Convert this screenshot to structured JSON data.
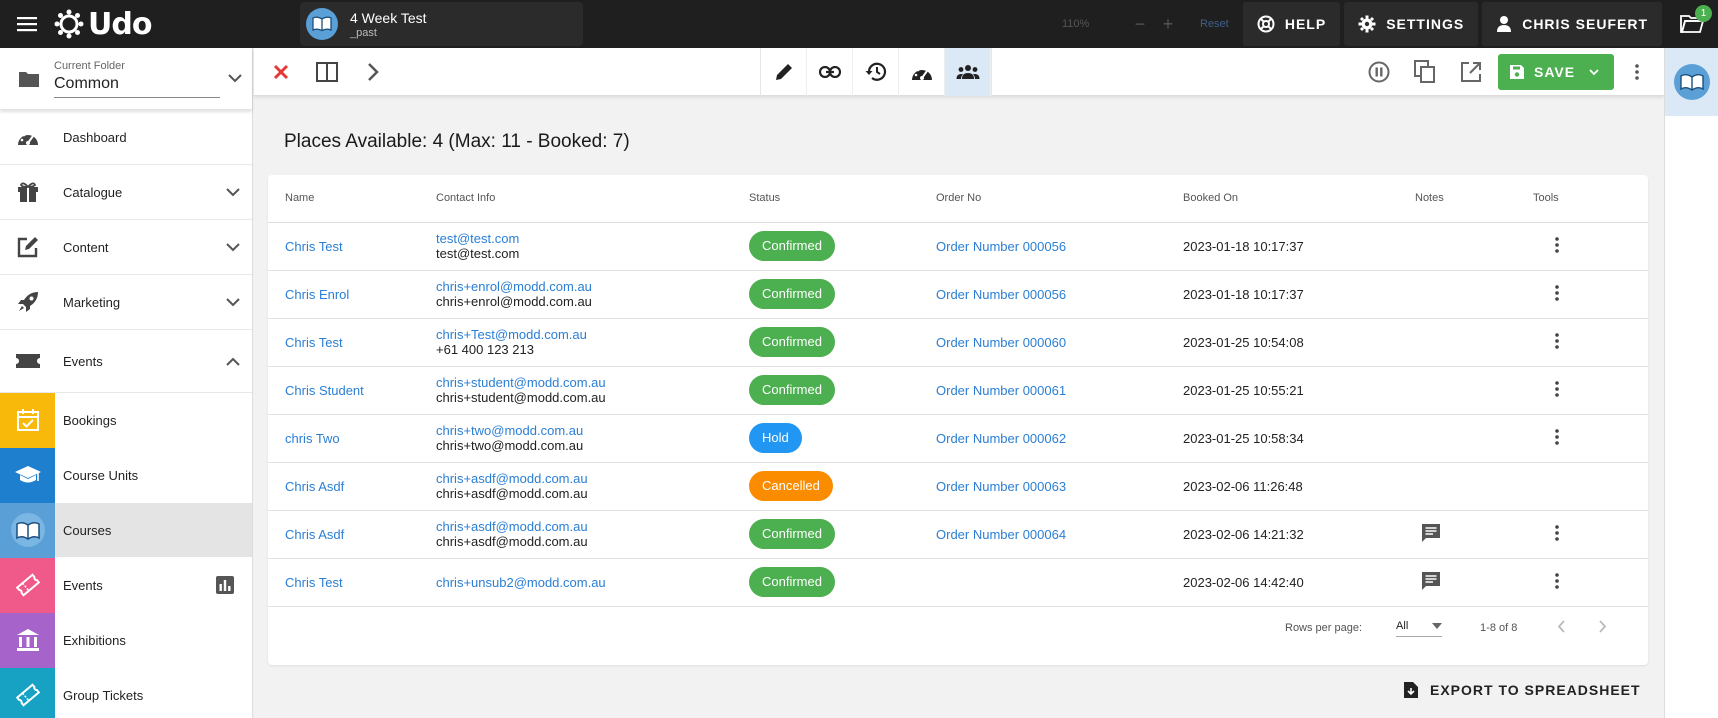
{
  "app": {
    "logo_text": "Udo",
    "document": {
      "title": "4 Week Test",
      "subtitle": "_past"
    },
    "zoom": {
      "value": "110%",
      "reset_label": "Reset"
    },
    "help_label": "HELP",
    "settings_label": "SETTINGS",
    "user_label": "CHRIS SEUFERT",
    "folder_badge": "1"
  },
  "sidebar": {
    "folder_caption": "Current Folder",
    "folder_value": "Common",
    "items": [
      {
        "label": "Dashboard"
      },
      {
        "label": "Catalogue"
      },
      {
        "label": "Content"
      },
      {
        "label": "Marketing"
      },
      {
        "label": "Events"
      }
    ],
    "sub_items": [
      {
        "label": "Bookings",
        "color": "#f9b90b"
      },
      {
        "label": "Course Units",
        "color": "#1e7fcf"
      },
      {
        "label": "Courses",
        "color": "#5a9fd6"
      },
      {
        "label": "Events",
        "color": "#ef5a8b"
      },
      {
        "label": "Exhibitions",
        "color": "#a663c9"
      },
      {
        "label": "Group Tickets",
        "color": "#17a2c4"
      }
    ]
  },
  "toolbar": {
    "save_label": "SAVE"
  },
  "main": {
    "places_text": "Places Available: 4 (Max: 11 - Booked: 7)",
    "columns": [
      "Name",
      "Contact Info",
      "Status",
      "Order No",
      "Booked On",
      "Notes",
      "Tools"
    ],
    "rows": [
      {
        "name": "Chris Test",
        "email": "test@test.com",
        "contact2": "test@test.com",
        "status": "Confirmed",
        "status_color": "green",
        "order": "Order Number 000056",
        "booked": "2023-01-18 10:17:37",
        "notes": false,
        "tools": true
      },
      {
        "name": "Chris Enrol",
        "email": "chris+enrol@modd.com.au",
        "contact2": "chris+enrol@modd.com.au",
        "status": "Confirmed",
        "status_color": "green",
        "order": "Order Number 000056",
        "booked": "2023-01-18 10:17:37",
        "notes": false,
        "tools": true
      },
      {
        "name": "Chris Test",
        "email": "chris+Test@modd.com.au",
        "contact2": "+61 400 123 213",
        "status": "Confirmed",
        "status_color": "green",
        "order": "Order Number 000060",
        "booked": "2023-01-25 10:54:08",
        "notes": false,
        "tools": true
      },
      {
        "name": "Chris Student",
        "email": "chris+student@modd.com.au",
        "contact2": "chris+student@modd.com.au",
        "status": "Confirmed",
        "status_color": "green",
        "order": "Order Number 000061",
        "booked": "2023-01-25 10:55:21",
        "notes": false,
        "tools": true
      },
      {
        "name": "chris Two",
        "email": "chris+two@modd.com.au",
        "contact2": "chris+two@modd.com.au",
        "status": "Hold",
        "status_color": "blue",
        "order": "Order Number 000062",
        "booked": "2023-01-25 10:58:34",
        "notes": false,
        "tools": true
      },
      {
        "name": "Chris Asdf",
        "email": "chris+asdf@modd.com.au",
        "contact2": "chris+asdf@modd.com.au",
        "status": "Cancelled",
        "status_color": "orange",
        "order": "Order Number 000063",
        "booked": "2023-02-06 11:26:48",
        "notes": false,
        "tools": false
      },
      {
        "name": "Chris Asdf",
        "email": "chris+asdf@modd.com.au",
        "contact2": "chris+asdf@modd.com.au",
        "status": "Confirmed",
        "status_color": "green",
        "order": "Order Number 000064",
        "booked": "2023-02-06 14:21:32",
        "notes": true,
        "tools": true
      },
      {
        "name": "Chris Test",
        "email": "chris+unsub2@modd.com.au",
        "contact2": "",
        "status": "Confirmed",
        "status_color": "green",
        "order": "",
        "booked": "2023-02-06 14:42:40",
        "notes": true,
        "tools": true
      }
    ],
    "rows_per_page_label": "Rows per page:",
    "rows_per_page_value": "All",
    "range_text": "1-8 of 8",
    "export_label": "EXPORT TO SPREADSHEET"
  }
}
